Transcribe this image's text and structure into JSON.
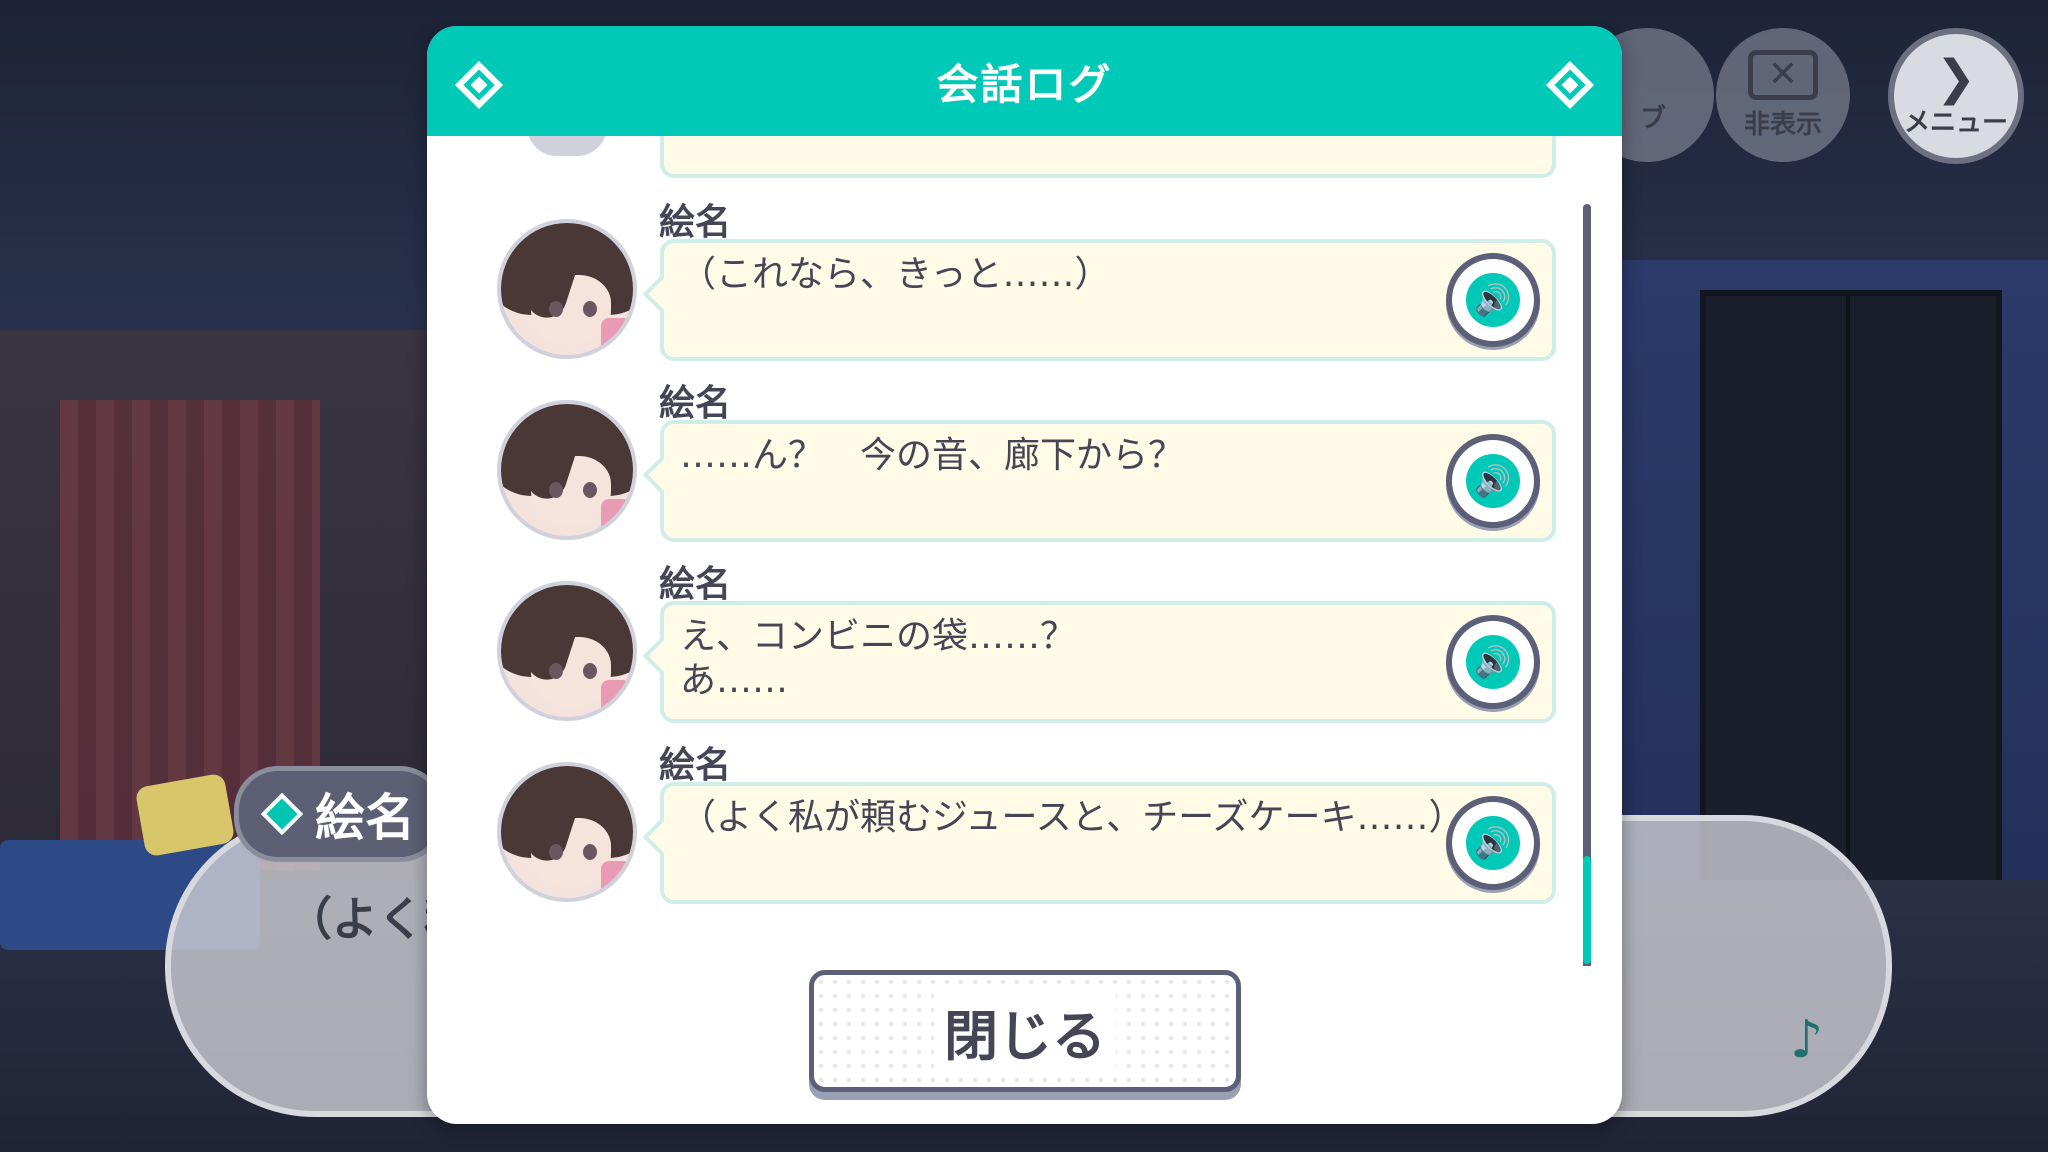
{
  "dialog": {
    "title": "会話ログ",
    "close_label": "閉じる",
    "entries": [
      {
        "speaker": "絵名",
        "text": "（これなら、きっと……）"
      },
      {
        "speaker": "絵名",
        "text": "……ん？　今の音、廊下から？"
      },
      {
        "speaker": "絵名",
        "text": "え、コンビニの袋……？\nあ……"
      },
      {
        "speaker": "絵名",
        "text": "（よく私が頼むジュースと、チーズケーキ……）"
      }
    ]
  },
  "top_buttons": {
    "log_partial": "ブ",
    "hide": "非表示",
    "menu": "メニュー"
  },
  "background_message": {
    "speaker": "絵名",
    "text": "（よく私"
  },
  "colors": {
    "accent": "#00c9b7",
    "bubble_bg": "#fffbe6",
    "text": "#444655"
  }
}
